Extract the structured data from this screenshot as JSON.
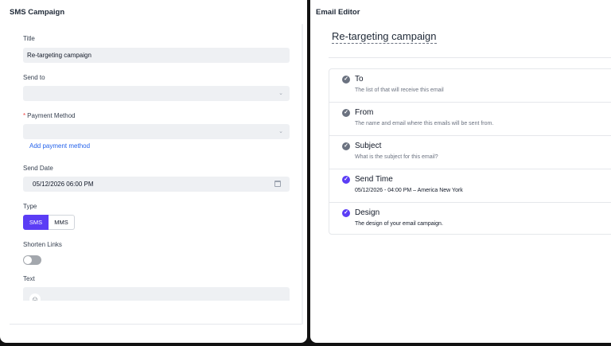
{
  "left_panel": {
    "header": "SMS Campaign",
    "title_field": {
      "label": "Title",
      "value": "Re-targeting campaign"
    },
    "send_to_field": {
      "label": "Send to",
      "value": ""
    },
    "payment_method_field": {
      "required_marker": "*",
      "label": "Payment Method",
      "value": ""
    },
    "add_payment_link": "Add payment method",
    "send_date_field": {
      "label": "Send Date",
      "value": "05/12/2026 06:00 PM"
    },
    "type_field": {
      "label": "Type",
      "options": [
        "SMS",
        "MMS"
      ],
      "selected": "SMS"
    },
    "shorten_links": {
      "label": "Shorten Links",
      "enabled": false
    },
    "text_field": {
      "label": "Text"
    }
  },
  "right_panel": {
    "header": "Email Editor",
    "email_title": "Re-targeting campaign",
    "sections": [
      {
        "title": "To",
        "subtitle": "The list of that will receive this email",
        "status": "pending"
      },
      {
        "title": "From",
        "subtitle": "The name and email where this emails will be sent from.",
        "status": "pending"
      },
      {
        "title": "Subject",
        "subtitle": "What is the subject for this email?",
        "status": "pending"
      },
      {
        "title": "Send Time",
        "subtitle": "05/12/2026 - 04:00 PM – America New York",
        "status": "complete"
      },
      {
        "title": "Design",
        "subtitle": "The design of your email campaign.",
        "status": "complete"
      }
    ]
  },
  "colors": {
    "accent": "#5b3df5",
    "link": "#2563eb",
    "input_bg": "#eef0f3",
    "pending_icon": "#6b7280"
  }
}
